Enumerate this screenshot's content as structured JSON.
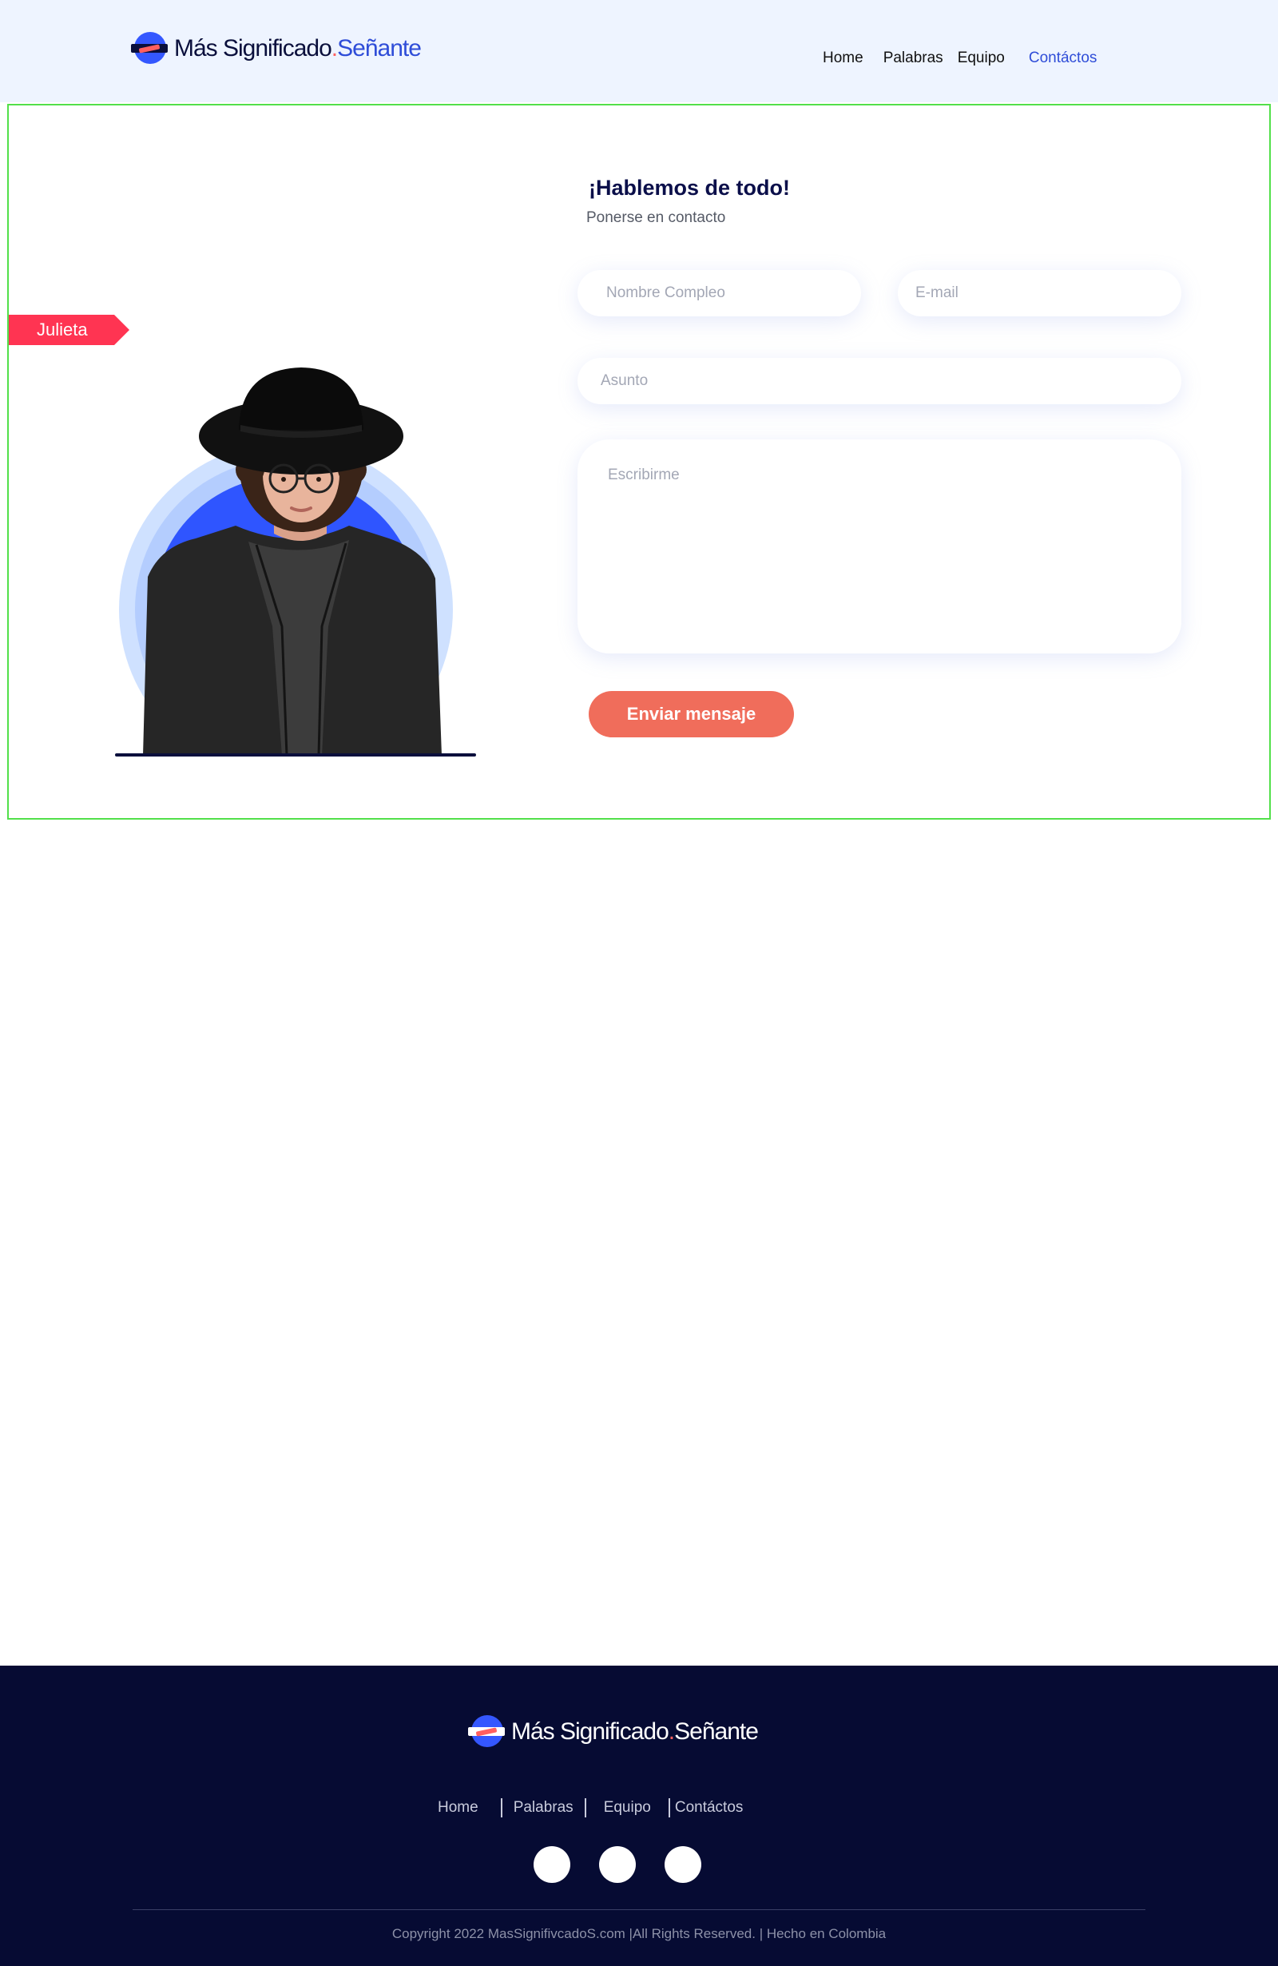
{
  "brand": {
    "name_a": "Más Significado",
    "dot": ".",
    "name_b": "Señante"
  },
  "nav": {
    "items": [
      "Home",
      "Palabras",
      "Equipo",
      "Contáctos"
    ],
    "active": "Contáctos"
  },
  "contact": {
    "tag_label": "Julieta",
    "title": "¡Hablemos de todo!",
    "subtitle": "Ponerse en contacto",
    "fields": {
      "name_placeholder": "Nombre Compleo",
      "email_placeholder": "E-mail",
      "subject_placeholder": "Asunto",
      "message_placeholder": "Escribirme"
    },
    "submit_label": "Enviar mensaje"
  },
  "footer": {
    "nav_items": [
      "Home",
      "Palabras",
      "Equipo",
      "Contáctos"
    ],
    "copyright": "Copyright 2022 MasSignifivcadoS.com |All Rights Reserved.  |  Hecho en Colombia"
  },
  "colors": {
    "header_bg": "#eef4ff",
    "accent_blue": "#2f4dd8",
    "accent_red": "#ff3452",
    "button": "#f06d5b",
    "footer_bg": "#060b33",
    "section_border": "#52e04a"
  },
  "icons": [
    "logo-mark-icon",
    "social-icon"
  ]
}
